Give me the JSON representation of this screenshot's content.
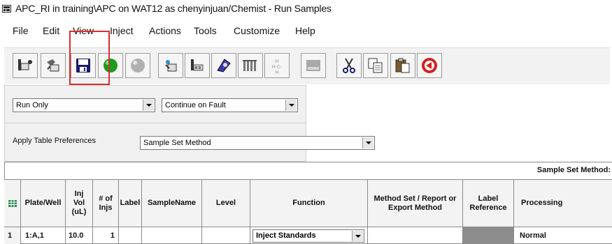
{
  "window": {
    "title": "APC_RI in training\\APC on WAT12 as chenyinjuan/Chemist - Run Samples"
  },
  "menu": {
    "items": [
      "File",
      "Edit",
      "View",
      "Inject",
      "Actions",
      "Tools",
      "Customize",
      "Help"
    ]
  },
  "toolbar": {
    "buttons": [
      "load-samples-icon",
      "new-sample-set-icon",
      "save-icon",
      "start-run-icon",
      "stop-run-icon",
      "edit-method-icon",
      "inject-icon",
      "instrument-icon",
      "columns-icon",
      "structure-icon",
      "grid-icon",
      "cut-icon",
      "copy-icon",
      "paste-icon",
      "abort-icon"
    ]
  },
  "controls": {
    "run_mode": "Run Only",
    "fault_mode": "Continue on Fault",
    "apply_label": "Apply Table Preferences",
    "apply_value": "Sample Set Method"
  },
  "table": {
    "group_label": "Sample Set Method:",
    "headers": [
      "Plate/Well",
      "Inj Vol (uL)",
      "# of Injs",
      "Label",
      "SampleName",
      "Level",
      "Function",
      "Method Set / Report or Export Method",
      "Label Reference",
      "Processing"
    ],
    "rows": [
      {
        "num": "1",
        "plate_well": "1:A,1",
        "inj_vol": "10.0",
        "num_injs": "1",
        "label": "",
        "sample_name": "",
        "level": "",
        "function": "Inject Standards",
        "method_set": "",
        "label_reference": "",
        "processing": "Normal"
      }
    ]
  },
  "colors": {
    "highlight": "#d92c2c",
    "label_ref_cell": "#8c8c8c"
  }
}
